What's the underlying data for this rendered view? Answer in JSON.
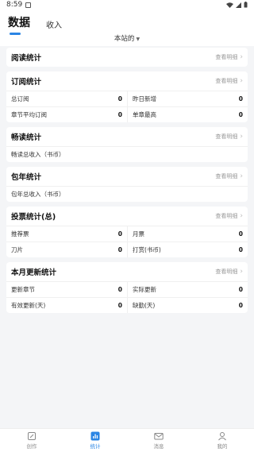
{
  "status": {
    "time": "8:59"
  },
  "header": {
    "tabs": [
      {
        "label": "数据",
        "active": true
      },
      {
        "label": "收入",
        "active": false
      }
    ],
    "scope_label": "本站的"
  },
  "cards": {
    "reading": {
      "title": "阅读统计",
      "detail": "查看明细"
    },
    "subscription": {
      "title": "订阅统计",
      "detail": "查看明细",
      "items": [
        {
          "label": "总订阅",
          "value": "0"
        },
        {
          "label": "昨日新增",
          "value": "0"
        },
        {
          "label": "章节平均订阅",
          "value": "0"
        },
        {
          "label": "单章最高",
          "value": "0"
        }
      ]
    },
    "smooth": {
      "title": "畅读统计",
      "detail": "查看明细",
      "items": [
        {
          "label": "畅读总收入（书币）",
          "value": ""
        }
      ]
    },
    "annual": {
      "title": "包年统计",
      "detail": "查看明细",
      "items": [
        {
          "label": "包年总收入（书币）",
          "value": ""
        }
      ]
    },
    "vote": {
      "title": "投票统计(总)",
      "detail": "查看明细",
      "items": [
        {
          "label": "推荐票",
          "value": "0"
        },
        {
          "label": "月票",
          "value": "0"
        },
        {
          "label": "刀片",
          "value": "0"
        },
        {
          "label": "打赏(书币)",
          "value": "0"
        }
      ]
    },
    "update": {
      "title": "本月更新统计",
      "detail": "查看明细",
      "items": [
        {
          "label": "更新章节",
          "value": "0"
        },
        {
          "label": "实际更新",
          "value": "0"
        },
        {
          "label": "有效更新(天)",
          "value": "0"
        },
        {
          "label": "缺勤(天)",
          "value": "0"
        }
      ]
    }
  },
  "nav": [
    {
      "label": "创作",
      "icon": "edit-icon",
      "active": false
    },
    {
      "label": "统计",
      "icon": "chart-icon",
      "active": true
    },
    {
      "label": "消息",
      "icon": "mail-icon",
      "active": false
    },
    {
      "label": "我的",
      "icon": "user-icon",
      "active": false
    }
  ],
  "colors": {
    "accent": "#2b85e4",
    "background": "#f4f5f7"
  }
}
